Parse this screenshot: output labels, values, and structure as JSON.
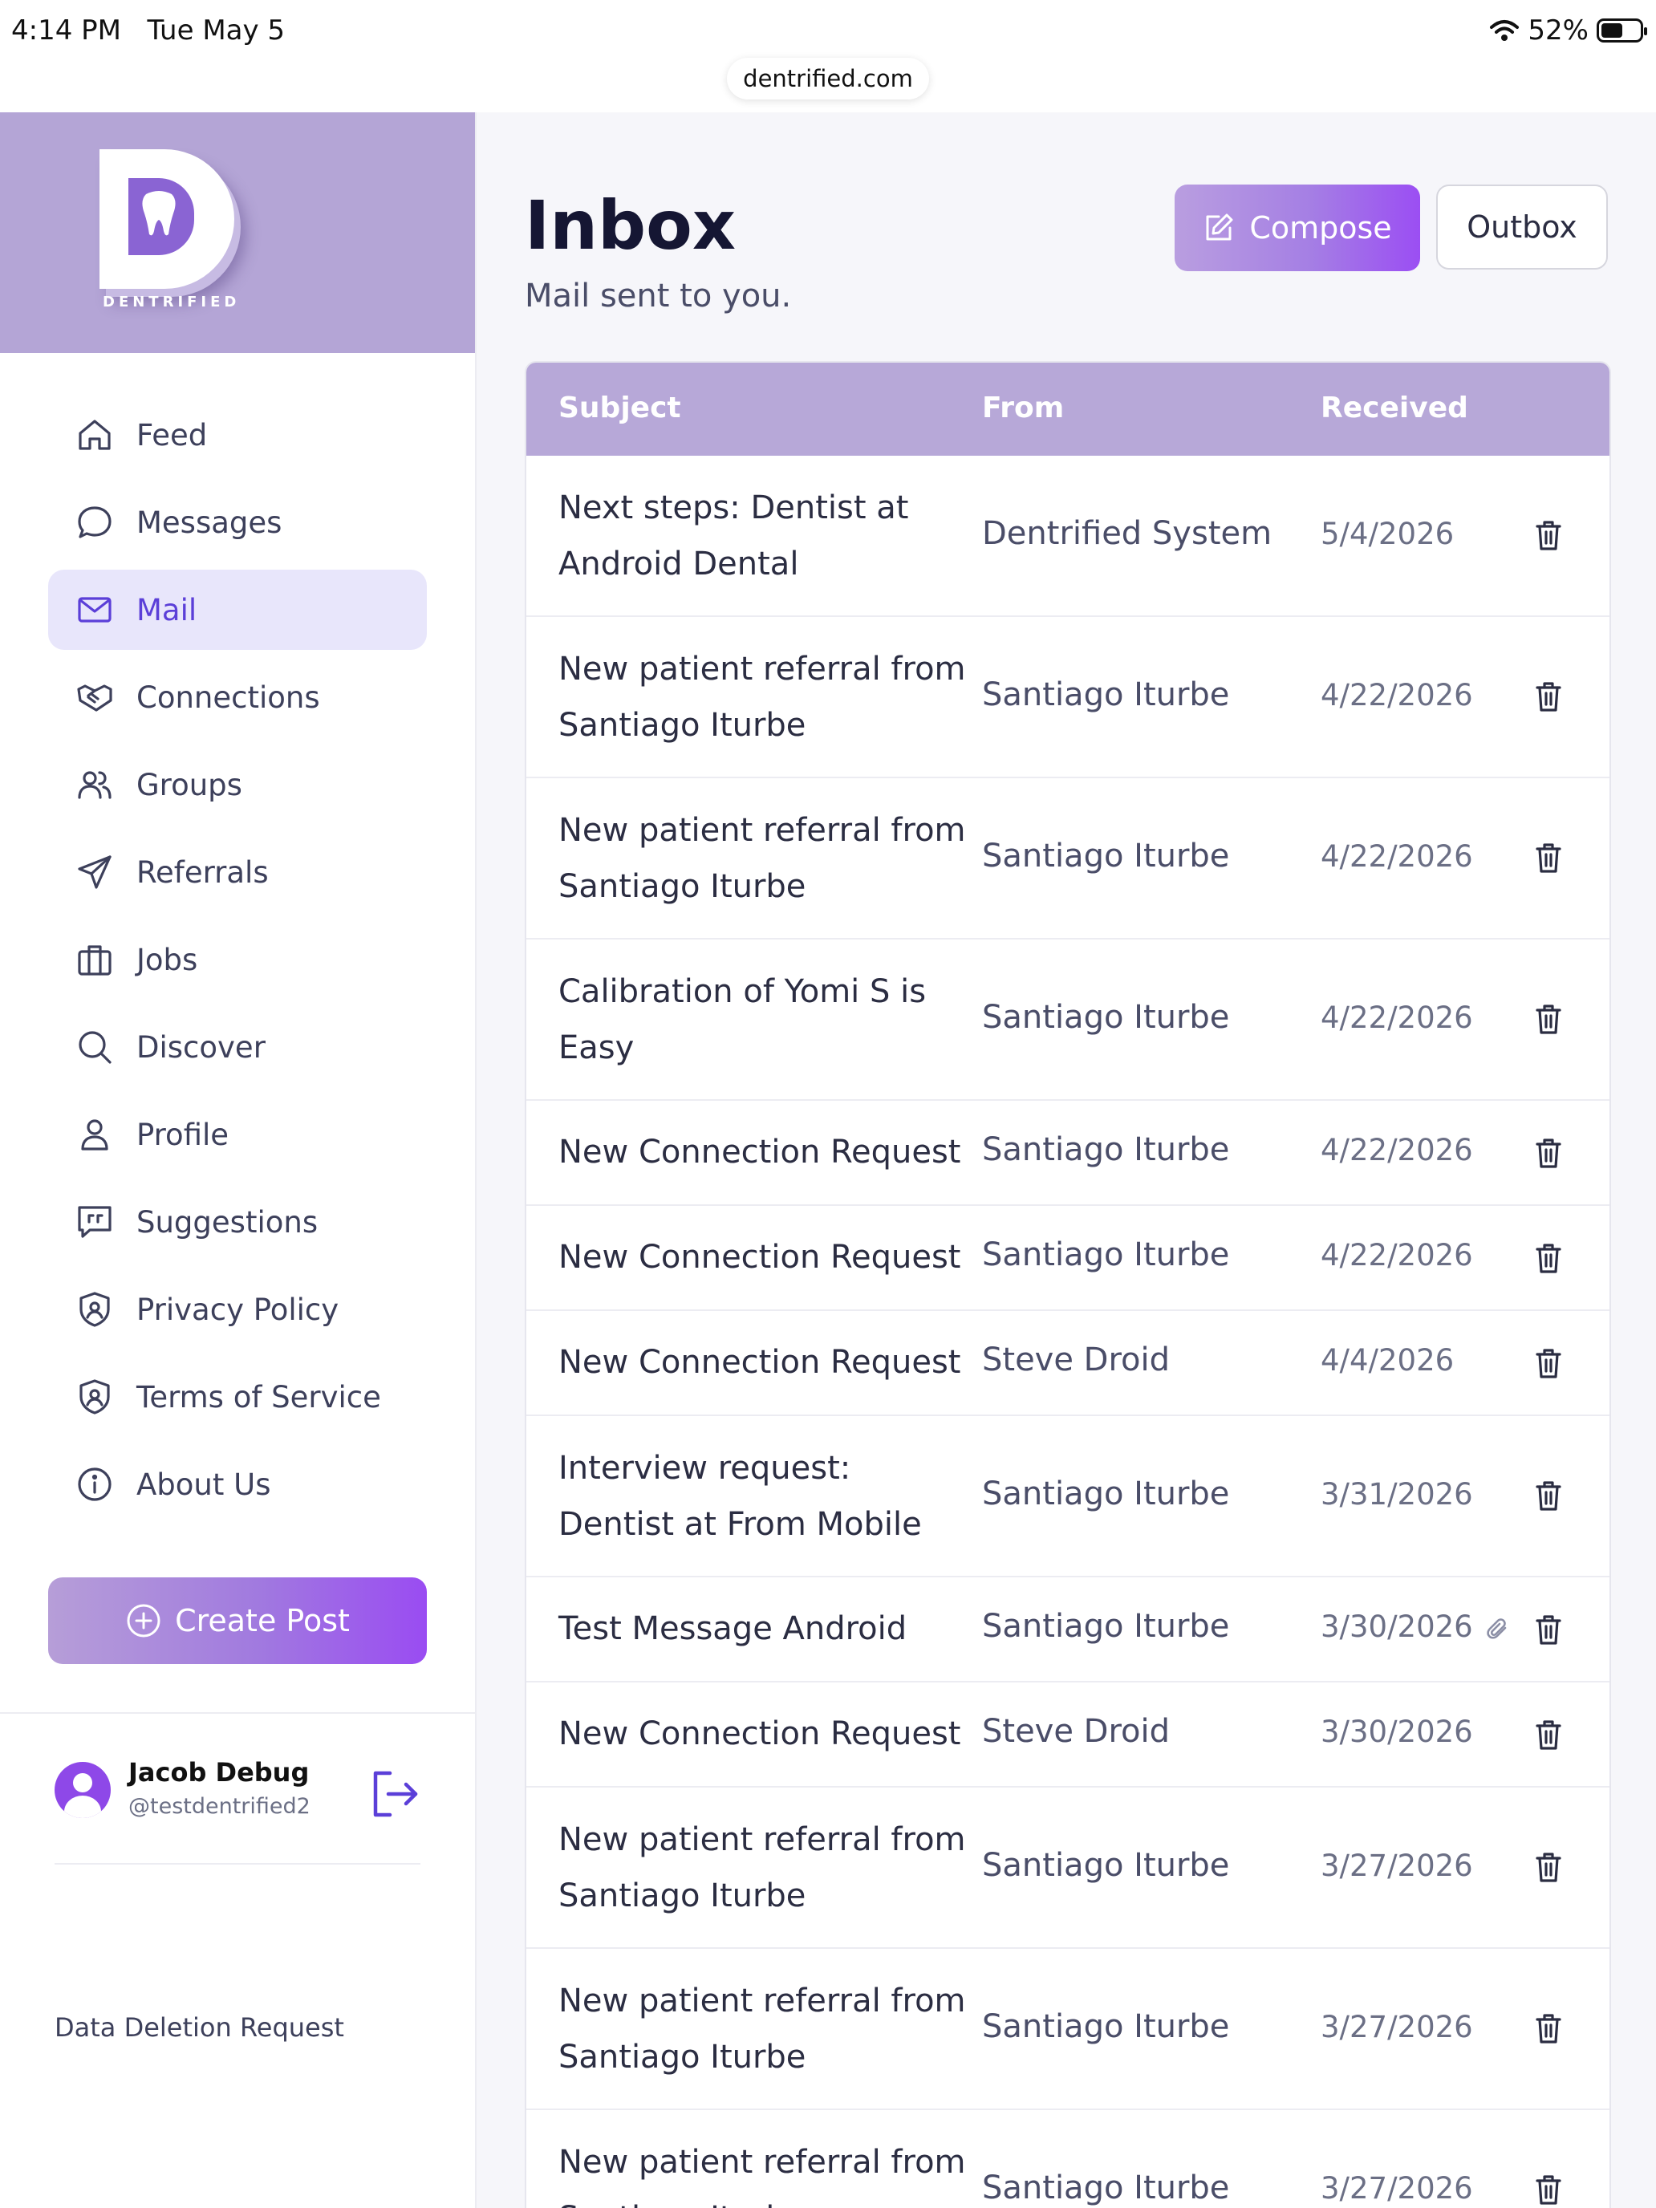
{
  "status_bar": {
    "time": "4:14 PM",
    "date": "Tue May 5",
    "battery": "52%",
    "url": "dentrified.com"
  },
  "brand": {
    "logo_text": "DENTRIFIED"
  },
  "sidebar": {
    "items": [
      {
        "label": "Feed",
        "icon": "home-icon"
      },
      {
        "label": "Messages",
        "icon": "chat-bubble-icon"
      },
      {
        "label": "Mail",
        "icon": "mail-icon",
        "active": true
      },
      {
        "label": "Connections",
        "icon": "handshake-icon"
      },
      {
        "label": "Groups",
        "icon": "users-icon"
      },
      {
        "label": "Referrals",
        "icon": "send-icon"
      },
      {
        "label": "Jobs",
        "icon": "briefcase-icon"
      },
      {
        "label": "Discover",
        "icon": "search-icon"
      },
      {
        "label": "Profile",
        "icon": "user-icon"
      },
      {
        "label": "Suggestions",
        "icon": "quote-message-icon"
      },
      {
        "label": "Privacy Policy",
        "icon": "shield-icon"
      },
      {
        "label": "Terms of Service",
        "icon": "shield-icon"
      },
      {
        "label": "About Us",
        "icon": "info-icon"
      }
    ],
    "create_post": "Create Post",
    "user": {
      "name": "Jacob Debug",
      "handle": "@testdentrified2"
    },
    "data_deletion": "Data Deletion Request"
  },
  "main": {
    "title": "Inbox",
    "subtitle": "Mail sent to you.",
    "compose_label": "Compose",
    "outbox_label": "Outbox",
    "table": {
      "columns": [
        "Subject",
        "From",
        "Received"
      ],
      "rows": [
        {
          "subject": "Next steps: Dentist at Android Dental",
          "from": "Dentrified System",
          "received": "5/4/2026"
        },
        {
          "subject": "New patient referral from Santiago Iturbe",
          "from": "Santiago Iturbe",
          "received": "4/22/2026"
        },
        {
          "subject": "New patient referral from Santiago Iturbe",
          "from": "Santiago Iturbe",
          "received": "4/22/2026"
        },
        {
          "subject": "Calibration of Yomi S is Easy",
          "from": "Santiago Iturbe",
          "received": "4/22/2026"
        },
        {
          "subject": "New Connection Request",
          "from": "Santiago Iturbe",
          "received": "4/22/2026"
        },
        {
          "subject": "New Connection Request",
          "from": "Santiago Iturbe",
          "received": "4/22/2026"
        },
        {
          "subject": "New Connection Request",
          "from": "Steve Droid",
          "received": "4/4/2026"
        },
        {
          "subject": "Interview request: Dentist at From Mobile",
          "from": "Santiago Iturbe",
          "received": "3/31/2026"
        },
        {
          "subject": "Test Message Android",
          "from": "Santiago Iturbe",
          "received": "3/30/2026",
          "attachment": true
        },
        {
          "subject": "New Connection Request",
          "from": "Steve Droid",
          "received": "3/30/2026"
        },
        {
          "subject": "New patient referral from Santiago Iturbe",
          "from": "Santiago Iturbe",
          "received": "3/27/2026"
        },
        {
          "subject": "New patient referral from Santiago Iturbe",
          "from": "Santiago Iturbe",
          "received": "3/27/2026"
        },
        {
          "subject": "New patient referral from Santiago Iturbe",
          "from": "Santiago Iturbe",
          "received": "3/27/2026"
        }
      ]
    }
  },
  "colors": {
    "accent": "#5b3fd8",
    "header_band": "#b7a8d8",
    "active_nav_bg": "#e8e6fb"
  }
}
